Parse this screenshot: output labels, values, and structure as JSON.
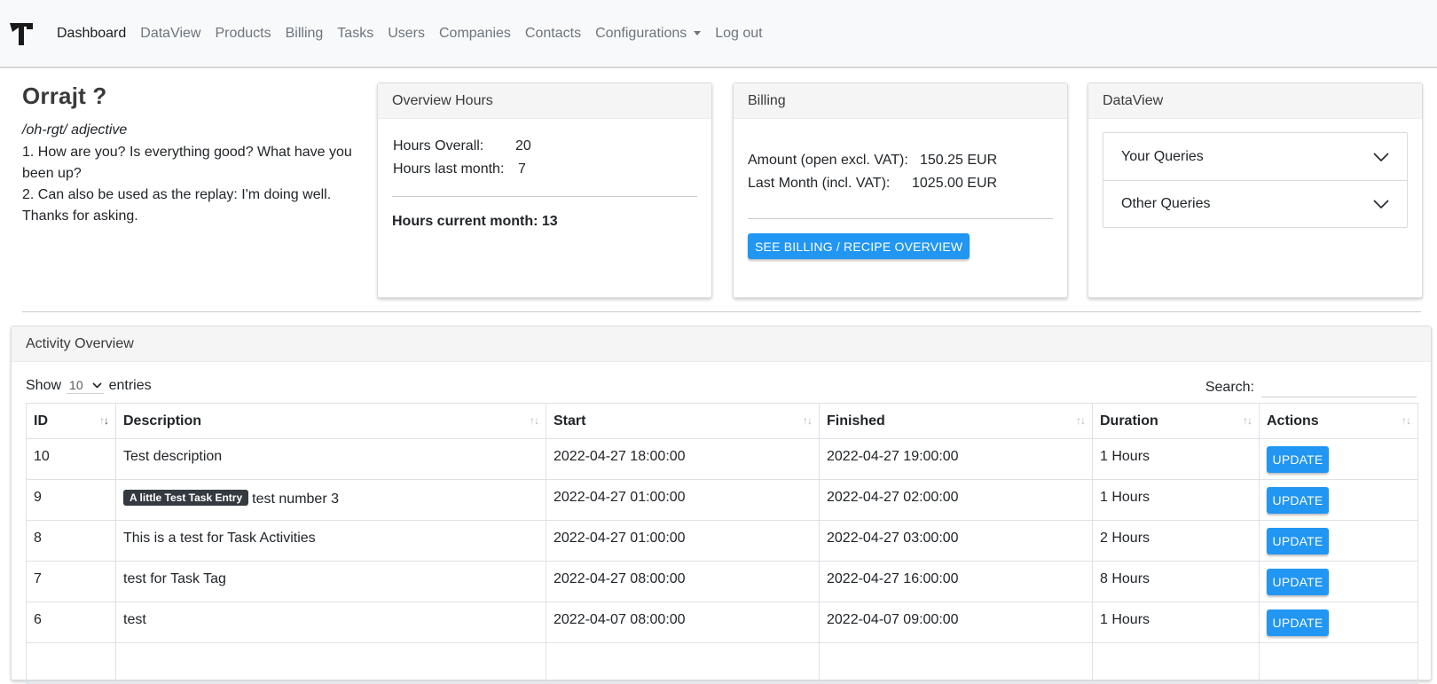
{
  "nav": {
    "items": [
      {
        "label": "Dashboard",
        "active": true
      },
      {
        "label": "DataView"
      },
      {
        "label": "Products"
      },
      {
        "label": "Billing"
      },
      {
        "label": "Tasks"
      },
      {
        "label": "Users"
      },
      {
        "label": "Companies"
      },
      {
        "label": "Contacts"
      },
      {
        "label": "Configurations",
        "dropdown": true
      },
      {
        "label": "Log out"
      }
    ]
  },
  "intro": {
    "title": "Orrajt ?",
    "phonetic": "/oh-rgt/ adjective",
    "line1": "1. How are you? Is everything good? What have you been up?",
    "line2": "2. Can also be used as the replay: I'm doing well. Thanks for asking."
  },
  "hours": {
    "header": "Overview Hours",
    "overall_label": "Hours Overall:",
    "overall_value": "20",
    "last_month_label": "Hours last month:",
    "last_month_value": "7",
    "current_month": "Hours current month: 13"
  },
  "billing": {
    "header": "Billing",
    "amount_label": "Amount (open excl. VAT):",
    "amount_value": "150.25 EUR",
    "last_month_label": "Last Month (incl. VAT):",
    "last_month_value": "1025.00 EUR",
    "button": "SEE BILLING / RECIPE OVERVIEW"
  },
  "dataview": {
    "header": "DataView",
    "items": [
      "Your Queries",
      "Other Queries"
    ]
  },
  "activity": {
    "header": "Activity Overview",
    "show_label": "Show",
    "entries_value": "10",
    "entries_label": "entries",
    "search_label": "Search:",
    "columns": [
      "ID",
      "Description",
      "Start",
      "Finished",
      "Duration",
      "Actions"
    ],
    "rows": [
      {
        "id": "10",
        "tag": "",
        "desc": "Test description",
        "start": "2022-04-27 18:00:00",
        "finished": "2022-04-27 19:00:00",
        "duration": "1 Hours",
        "action": "UPDATE"
      },
      {
        "id": "9",
        "tag": "A little Test Task Entry",
        "desc": "test number 3",
        "start": "2022-04-27 01:00:00",
        "finished": "2022-04-27 02:00:00",
        "duration": "1 Hours",
        "action": "UPDATE"
      },
      {
        "id": "8",
        "tag": "",
        "desc": "This is a test for Task Activities",
        "start": "2022-04-27 01:00:00",
        "finished": "2022-04-27 03:00:00",
        "duration": "2 Hours",
        "action": "UPDATE"
      },
      {
        "id": "7",
        "tag": "",
        "desc": "test for Task Tag",
        "start": "2022-04-27 08:00:00",
        "finished": "2022-04-27 16:00:00",
        "duration": "8 Hours",
        "action": "UPDATE"
      },
      {
        "id": "6",
        "tag": "",
        "desc": "test",
        "start": "2022-04-07 08:00:00",
        "finished": "2022-04-07 09:00:00",
        "duration": "1 Hours",
        "action": "UPDATE"
      }
    ]
  }
}
